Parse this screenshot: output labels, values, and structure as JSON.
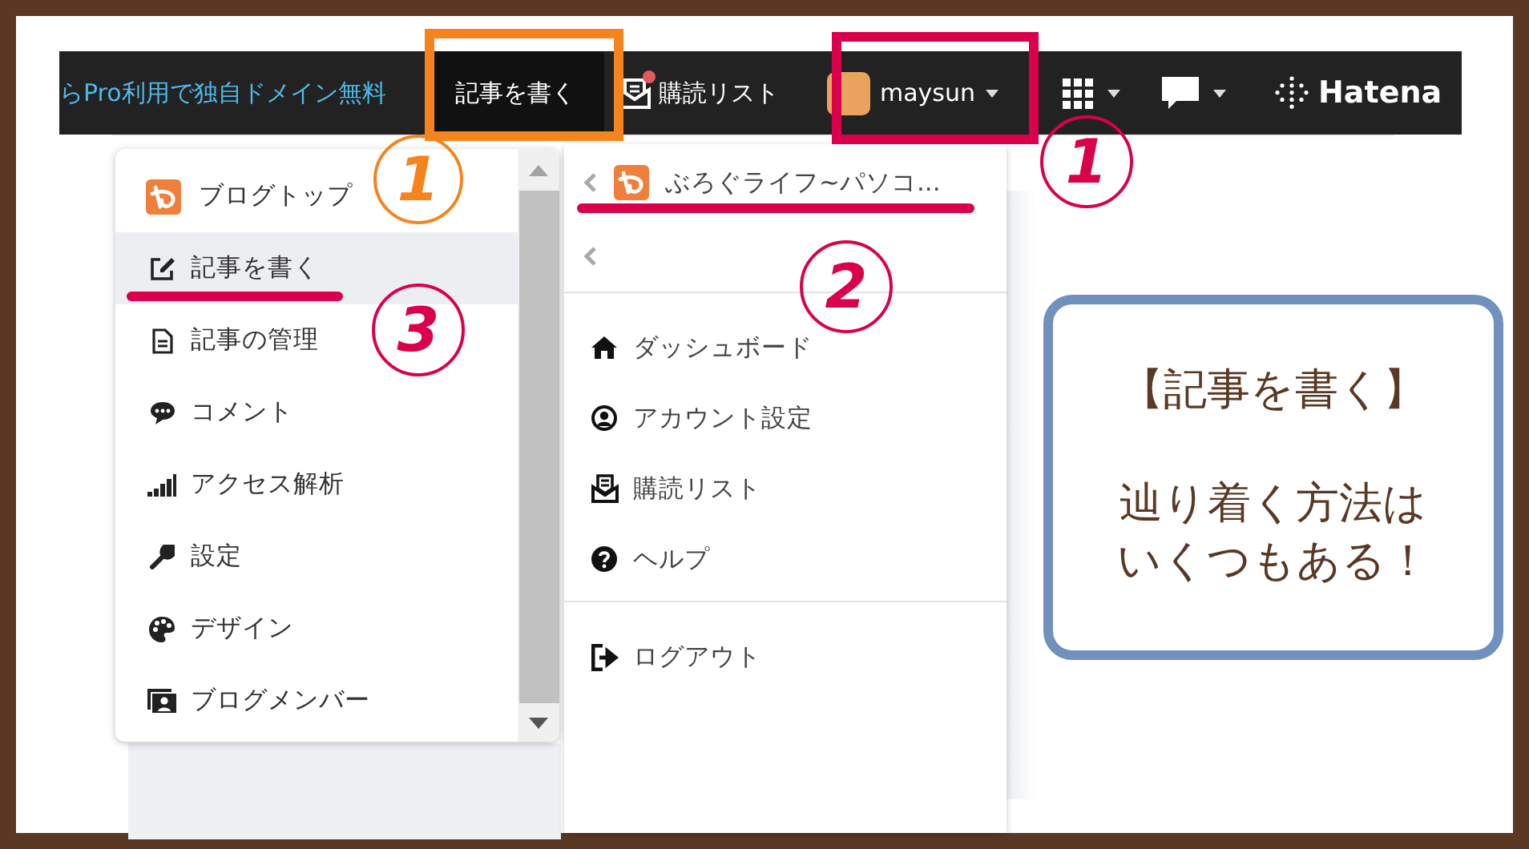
{
  "topbar": {
    "promo": "らPro利用で独自ドメイン無料",
    "write": "記事を書く",
    "reading_list": {
      "label": "購読リスト",
      "notification": true
    },
    "user": "maysun",
    "brand": "Hatena"
  },
  "blog_menu": {
    "items": [
      {
        "label": "ブログトップ",
        "selected": false
      },
      {
        "label": "記事を書く",
        "selected": true
      },
      {
        "label": "記事の管理",
        "selected": false
      },
      {
        "label": "コメント",
        "selected": false
      },
      {
        "label": "アクセス解析",
        "selected": false
      },
      {
        "label": "設定",
        "selected": false
      },
      {
        "label": "デザイン",
        "selected": false
      },
      {
        "label": "ブログメンバー",
        "selected": false
      }
    ]
  },
  "account_menu": {
    "blog_title": "ぶろぐライフ~パソコ...",
    "groups": [
      [
        "ダッシュボード",
        "アカウント設定",
        "購読リスト",
        "ヘルプ"
      ],
      [
        "ログアウト"
      ]
    ]
  },
  "annotations": [
    {
      "kind": "frame",
      "color": "#f5841f"
    },
    {
      "kind": "frame",
      "color": "#d9004c"
    },
    {
      "kind": "step",
      "label": "1",
      "color": "#f5841f"
    },
    {
      "kind": "step",
      "label": "1",
      "color": "#d9004c"
    },
    {
      "kind": "step",
      "label": "2",
      "color": "#d9004c"
    },
    {
      "kind": "step",
      "label": "3",
      "color": "#d9004c"
    },
    {
      "kind": "underline",
      "color": "#d9004c"
    },
    {
      "kind": "underline",
      "color": "#d9004c"
    }
  ],
  "callout": {
    "title": "【記事を書く】",
    "lines": [
      "辿り着く方法は",
      "いくつもある！"
    ]
  }
}
